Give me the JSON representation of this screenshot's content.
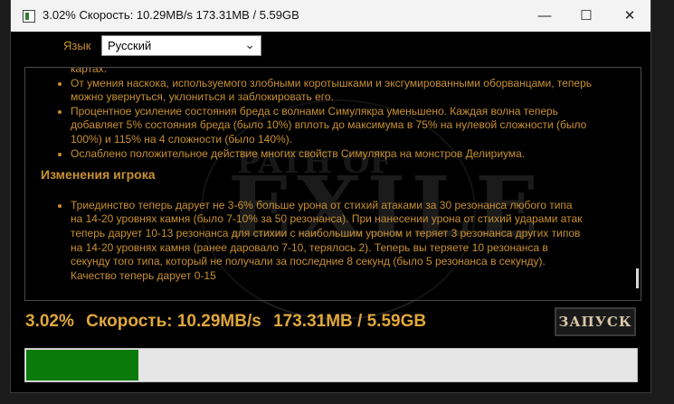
{
  "window": {
    "title": "3.02%  Скорость: 10.29MB/s  173.31MB / 5.59GB",
    "icons": {
      "app": "app-icon",
      "minimize": "minimize-icon",
      "maximize": "maximize-icon",
      "close": "close-icon"
    }
  },
  "language": {
    "label": "Язык",
    "selected": "Русский"
  },
  "background": {
    "logo_text": "EXILE",
    "sub_text": "PATH OF"
  },
  "notes": {
    "top_item_tail": "картах.",
    "items_top": [
      {
        "line1": "От умения наскока, используемого злобными коротышками и эксгумированными оборванцами, теперь",
        "line2": "можно увернуться, уклониться и заблокировать его."
      },
      {
        "line1": "Процентное усиление состояния бреда с волнами Симулякра уменьшено. Каждая волна теперь",
        "line2": "добавляет 5% состояния бреда (было 10%) вплоть до максимума в 75% на нулевой сложности (было",
        "line3": "100%) и 115% на 4 сложности (было 140%)."
      },
      {
        "line1": "Ослаблено положительное действие многих свойств Симулякра на монстров Делириума."
      }
    ],
    "section_heading": "Изменения игрока",
    "player_item": {
      "lines": [
        "Триединство теперь дарует не 3-6% больше урона от стихий атаками за 30 резонанса любого типа",
        "на 14-20 уровнях камня (было 7-10% за 50 резонанса). При нанесении урона от стихий ударами атак",
        "теперь дарует 10-13 резонанса для стихии с наибольшим уроном и теряет 3 резонанса других типов",
        "на 14-20 уровнях камня (ранее даровало 7-10, терялось 2). Теперь вы теряете 10 резонанса в",
        "секунду того типа, который не получали за последние 8 секунд (было 5 резонанса в секунду).",
        "Качество теперь дарует 0-15"
      ]
    }
  },
  "status": {
    "percent": "3.02%",
    "speed": "Скорость: 10.29MB/s",
    "size": "173.31MB / 5.59GB",
    "progress_fraction": 0.0302,
    "progress_color": "#0a7a0a"
  },
  "launch_button": {
    "label": "ЗАПУСК"
  },
  "colors": {
    "accent": "#c8902f",
    "status_text": "#e0a73a"
  }
}
